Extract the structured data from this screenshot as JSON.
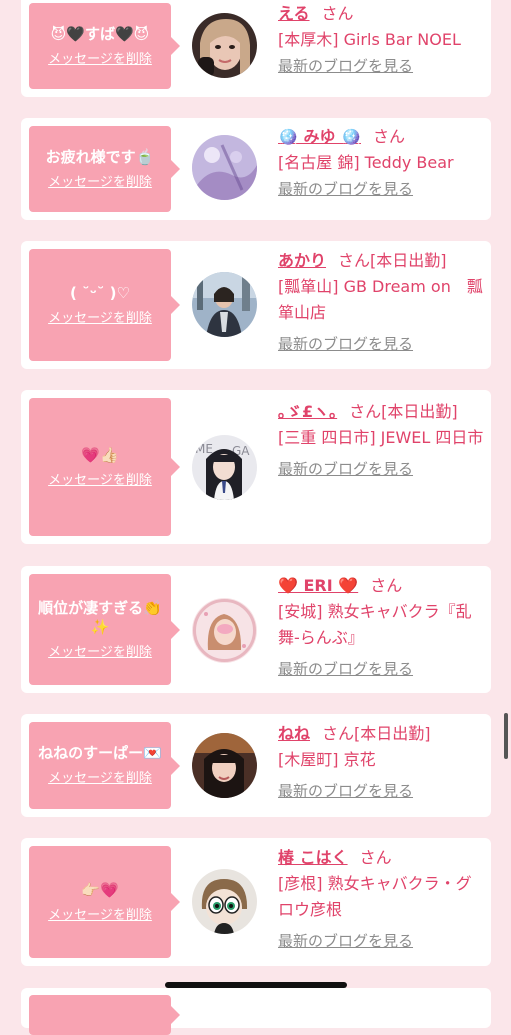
{
  "cards": [
    {
      "message": "😈🖤すば🖤😈",
      "delete_label": "メッセージを削除",
      "name": "える",
      "honorific": "さん",
      "status": "",
      "shop": "[本厚木] Girls Bar NOEL",
      "blog_label": "最新のブログを見る"
    },
    {
      "message": "お疲れ様です🍵",
      "delete_label": "メッセージを削除",
      "name": "🪩 みゆ 🪩",
      "honorific": "さん",
      "status": "",
      "shop": "[名古屋 錦] Teddy Bear",
      "blog_label": "最新のブログを見る"
    },
    {
      "message": "( ˘ᵕ˘ )♡",
      "delete_label": "メッセージを削除",
      "name": "あかり",
      "honorific": "さん",
      "status": "[本日出勤]",
      "shop": "[瓢箪山] GB Dream on　瓢箪山店",
      "blog_label": "最新のブログを見る"
    },
    {
      "message": "💗👍🏻",
      "delete_label": "メッセージを削除",
      "name": "｡ゞ£ヽ｡",
      "honorific": "さん",
      "status": "[本日出勤]",
      "shop": "[三重 四日市] JEWEL 四日市",
      "blog_label": "最新のブログを見る"
    },
    {
      "message": "順位が凄すぎる👏✨",
      "delete_label": "メッセージを削除",
      "name": "❤️ ERI ❤️",
      "honorific": "さん",
      "status": "",
      "shop": "[安城] 熟女キャバクラ『乱舞-らんぶ』",
      "blog_label": "最新のブログを見る"
    },
    {
      "message": "ねねのすーぱー💌",
      "delete_label": "メッセージを削除",
      "name": "ねね",
      "honorific": "さん",
      "status": "[本日出勤]",
      "shop": "[木屋町] 京花",
      "blog_label": "最新のブログを見る"
    },
    {
      "message": "👉🏻💗",
      "delete_label": "メッセージを削除",
      "name": "椿 こはく",
      "honorific": "さん",
      "status": "",
      "shop": "[彦根] 熟女キャバクラ・グロウ彦根",
      "blog_label": "最新のブログを見る"
    }
  ],
  "colors": {
    "page_bg": "#fbe6ea",
    "bubble": "#f8a3b2",
    "accent_text": "#e0436a",
    "link_gray": "#8c8c8c"
  },
  "icons": {
    "avatar": "profile-photo"
  }
}
